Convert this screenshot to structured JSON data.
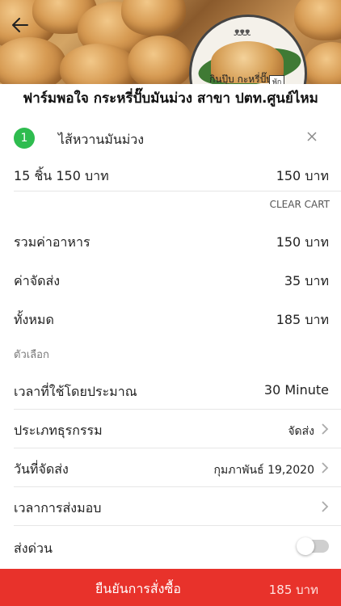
{
  "header": {
    "back_icon": "arrow-left-icon",
    "logo": {
      "brand_text": "กินปุ๊บ กะหรี่ปั๊บ",
      "tag_text": "พัก"
    }
  },
  "shop": {
    "title": "ฟาร์มพอใจ กระหรี่ปั๊บมันม่วง สาขา ปตท.ศูนย์ไหม"
  },
  "cart_item": {
    "quantity": "1",
    "name": "ไส้หวานมันม่วง",
    "remove_icon": "close-icon",
    "package_label": "15 ชิ้น 150 บาท",
    "price": "150 บาท"
  },
  "clear_cart_label": "CLEAR CART",
  "summary": {
    "food_total_label": "รวมค่าอาหาร",
    "food_total_value": "150 บาท",
    "delivery_fee_label": "ค่าจัดส่ง",
    "delivery_fee_value": "35 บาท",
    "grand_total_label": "ทั้งหมด",
    "grand_total_value": "185 บาท"
  },
  "options": {
    "section_label": "ตัวเลือก",
    "est_time_label": "เวลาที่ใช้โดยประมาณ",
    "est_time_value": "30 Minute",
    "txn_type_label": "ประเภทธุรกรรม",
    "txn_type_value": "จัดส่ง",
    "delivery_date_label": "วันที่จัดส่ง",
    "delivery_date_value": "กุมภาพันธ์ 19,2020",
    "delivery_time_label": "เวลาการส่งมอบ",
    "delivery_time_value": "",
    "urgent_label": "ส่งด่วน",
    "urgent_on": false
  },
  "footer": {
    "confirm_label": "ยืนยันการสั่งซื้อ",
    "total": "185 บาท"
  },
  "colors": {
    "accent_red": "#e8322b",
    "badge_green": "#2ebc4f"
  }
}
